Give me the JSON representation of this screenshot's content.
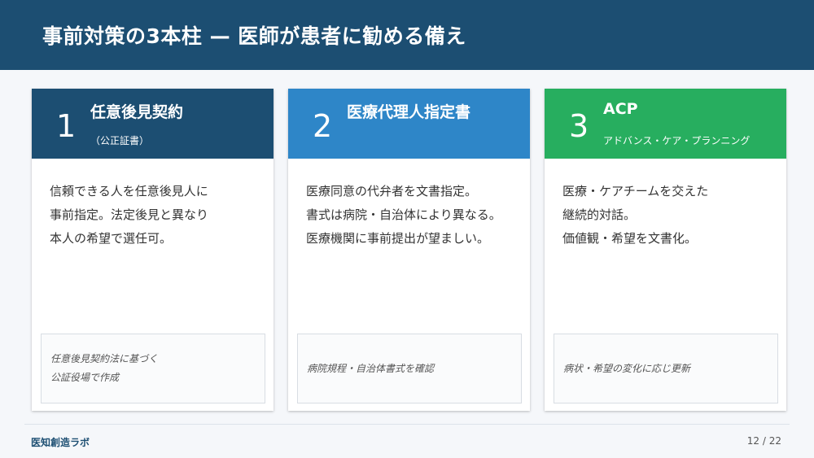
{
  "title": "事前対策の3本柱 — 医師が患者に勧める備え",
  "cards": [
    {
      "number": "1",
      "title": "任意後見契約",
      "subtitle": "（公正証書）",
      "color": "#1c4e72",
      "body": [
        "信頼できる人を任意後見人に",
        "事前指定。法定後見と異なり",
        "本人の希望で選任可。"
      ],
      "note": [
        "任意後見契約法に基づく",
        "公証役場で作成"
      ]
    },
    {
      "number": "2",
      "title": "医療代理人指定書",
      "subtitle": "",
      "color": "#2e86c8",
      "body": [
        "医療同意の代弁者を文書指定。",
        "書式は病院・自治体により異なる。",
        "医療機関に事前提出が望ましい。"
      ],
      "note": [
        "病院規程・自治体書式を確認"
      ]
    },
    {
      "number": "3",
      "title": "ACP",
      "subtitle": "アドバンス・ケア・プランニング",
      "color": "#27ae5f",
      "body": [
        "医療・ケアチームを交えた",
        "継続的対話。",
        "価値観・希望を文書化。"
      ],
      "note": [
        "病状・希望の変化に応じ更新"
      ]
    }
  ],
  "footer": {
    "brand": "医知創造ラボ",
    "page": "12 / 22"
  }
}
